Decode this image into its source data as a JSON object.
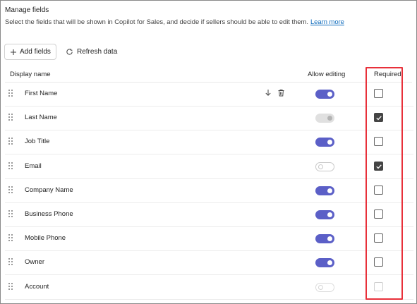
{
  "section": {
    "title": "Manage fields",
    "description": "Select the fields that will be shown in Copilot for Sales, and decide if sellers should be able to edit them.",
    "learn_more": "Learn more"
  },
  "toolbar": {
    "add_fields_label": "Add fields",
    "refresh_label": "Refresh data"
  },
  "columns": {
    "display_name": "Display name",
    "allow_editing": "Allow editing",
    "required": "Required"
  },
  "fields": [
    {
      "name": "First Name",
      "allow_editing": "on",
      "required": false,
      "show_actions": true
    },
    {
      "name": "Last Name",
      "allow_editing": "disabled-on",
      "required": true
    },
    {
      "name": "Job Title",
      "allow_editing": "on",
      "required": false
    },
    {
      "name": "Email",
      "allow_editing": "off",
      "required": true
    },
    {
      "name": "Company Name",
      "allow_editing": "on",
      "required": false
    },
    {
      "name": "Business Phone",
      "allow_editing": "on",
      "required": false
    },
    {
      "name": "Mobile Phone",
      "allow_editing": "on",
      "required": false
    },
    {
      "name": "Owner",
      "allow_editing": "on",
      "required": false
    },
    {
      "name": "Account",
      "allow_editing": "disabled-off",
      "required": false,
      "required_disabled": true
    }
  ],
  "colors": {
    "accent": "#5b5fc7",
    "link": "#0f6cbd",
    "highlight": "#e8303a"
  }
}
